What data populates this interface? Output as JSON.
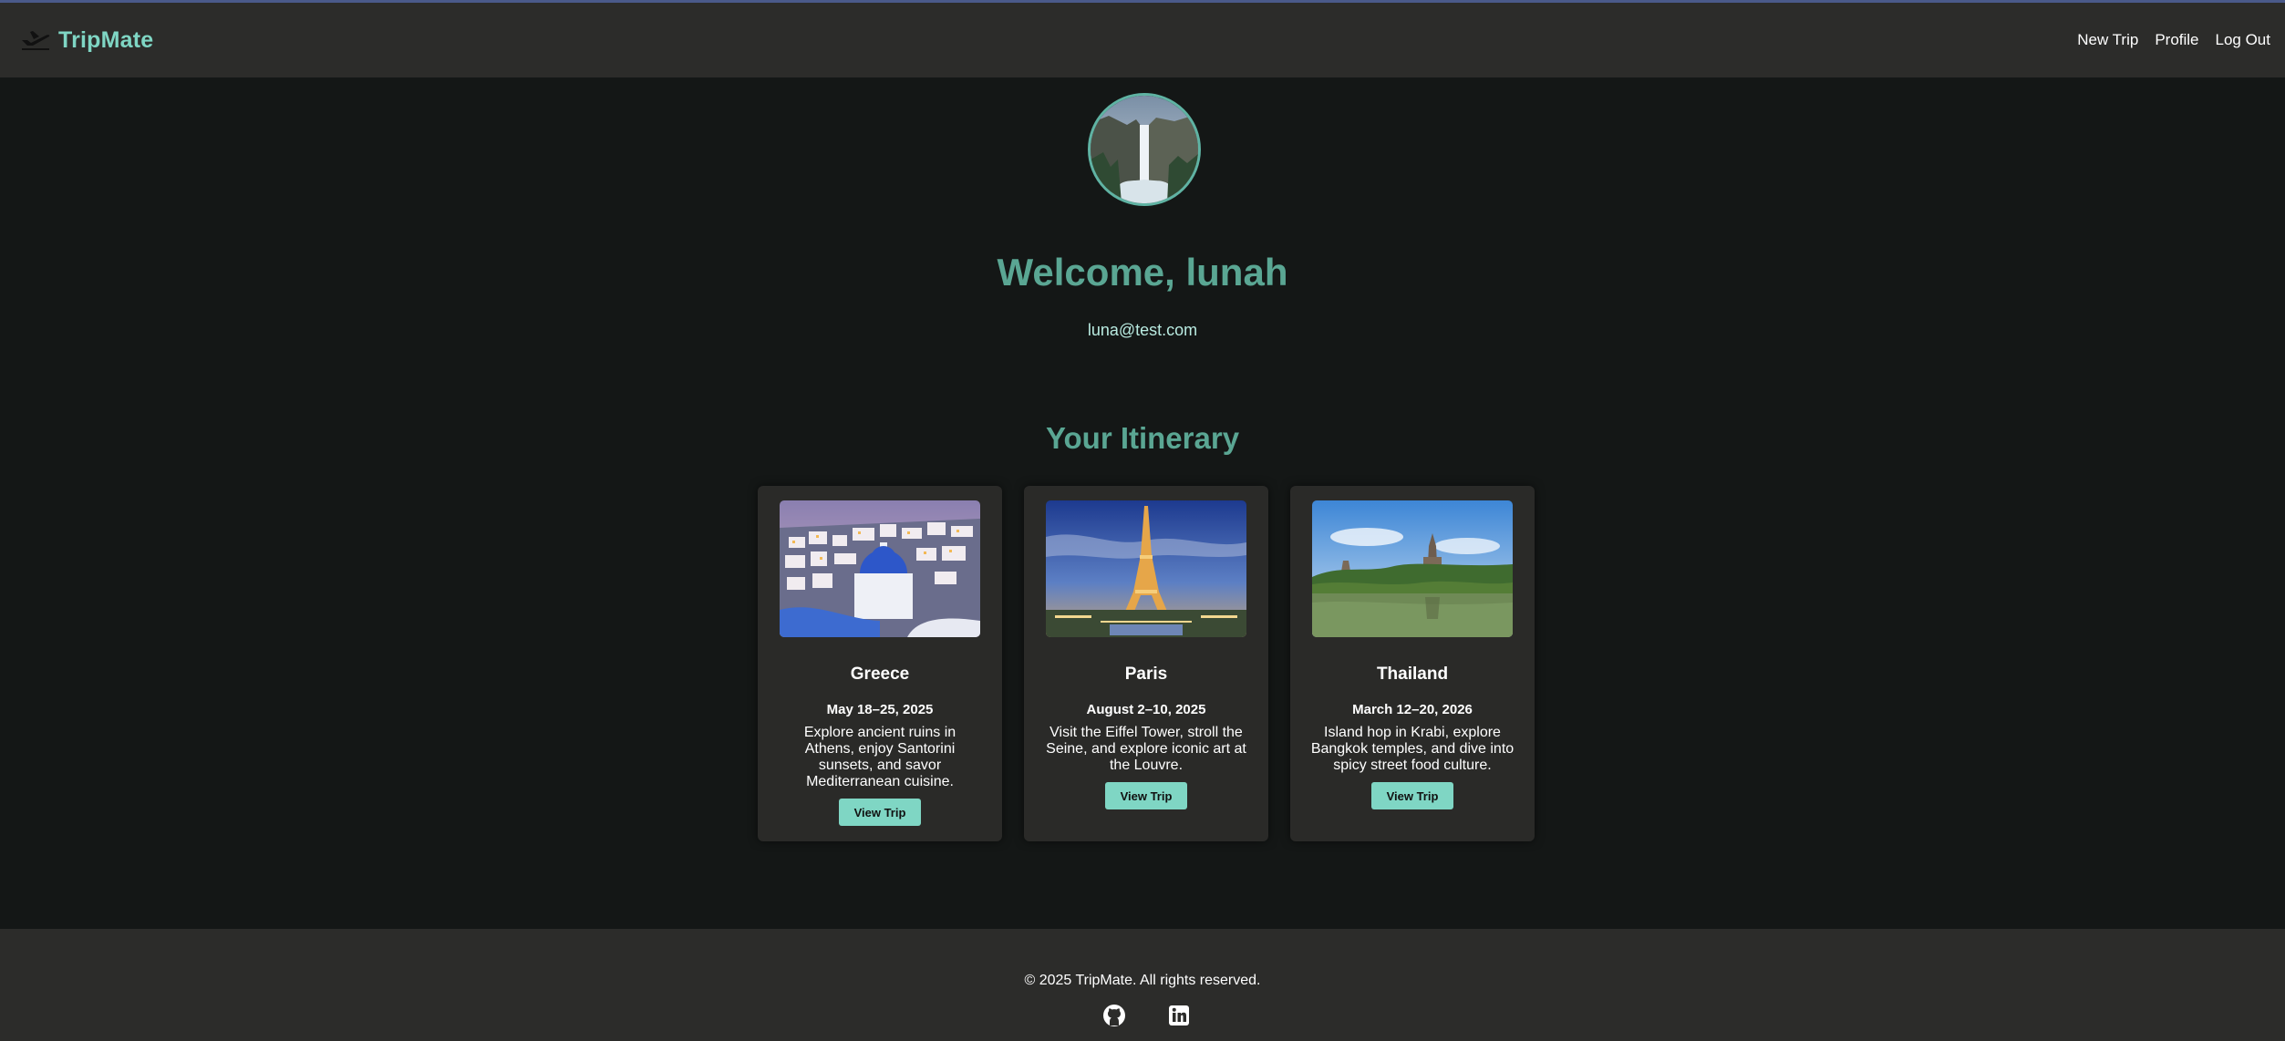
{
  "app": {
    "brand_name": "TripMate",
    "brand_icon": "airplane-departure-icon",
    "accent_color": "#7fd6c4",
    "heading_color": "#5aa693",
    "background_color": "#141716",
    "navbar_color": "#2c2c2a"
  },
  "nav": {
    "items": [
      {
        "label": "New Trip"
      },
      {
        "label": "Profile"
      },
      {
        "label": "Log Out"
      }
    ]
  },
  "profile": {
    "avatar_icon": "waterfall-avatar",
    "welcome": "Welcome, lunah",
    "email": "luna@test.com"
  },
  "itinerary": {
    "title": "Your Itinerary",
    "trips": [
      {
        "image": "santorini-image",
        "title": "Greece",
        "dates": "May 18–25, 2025",
        "description": "Explore ancient ruins in Athens, enjoy Santorini sunsets, and savor Mediterranean cuisine.",
        "button_label": "View Trip"
      },
      {
        "image": "eiffel-tower-image",
        "title": "Paris",
        "dates": "August 2–10, 2025",
        "description": "Visit the Eiffel Tower, stroll the Seine, and explore iconic art at the Louvre.",
        "button_label": "View Trip"
      },
      {
        "image": "thai-temple-image",
        "title": "Thailand",
        "dates": "March 12–20, 2026",
        "description": "Island hop in Krabi, explore Bangkok temples, and dive into spicy street food culture.",
        "button_label": "View Trip"
      }
    ]
  },
  "footer": {
    "copyright": "© 2025 TripMate. All rights reserved.",
    "social_icons": [
      "github-icon",
      "linkedin-icon"
    ]
  }
}
